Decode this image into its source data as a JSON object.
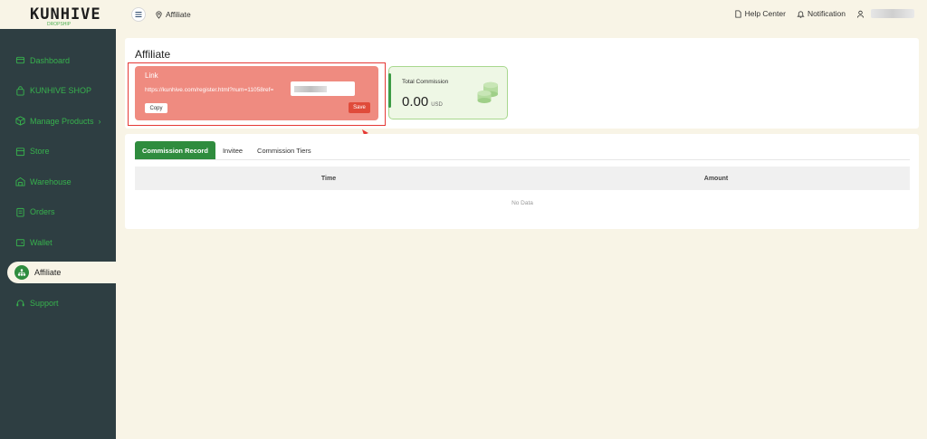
{
  "brand": {
    "logo_text": "KUNHIVE",
    "logo_sub": "DROPSHIP"
  },
  "sidebar": {
    "items": [
      {
        "label": "Dashboard",
        "icon": "dashboard-icon"
      },
      {
        "label": "KUNHIVE SHOP",
        "icon": "bag-icon"
      },
      {
        "label": "Manage Products",
        "icon": "box-icon",
        "chevron": "›"
      },
      {
        "label": "Store",
        "icon": "store-icon"
      },
      {
        "label": "Warehouse",
        "icon": "warehouse-icon"
      },
      {
        "label": "Orders",
        "icon": "orders-icon"
      },
      {
        "label": "Wallet",
        "icon": "wallet-icon"
      },
      {
        "label": "Affiliate",
        "icon": "affiliate-icon",
        "active": true
      },
      {
        "label": "Support",
        "icon": "support-icon"
      }
    ]
  },
  "topbar": {
    "breadcrumb": "Affiliate",
    "help_center": "Help Center",
    "notification": "Notification"
  },
  "page": {
    "title": "Affiliate"
  },
  "link_card": {
    "label": "Link",
    "url": "https://kunhive.com/register.html?num=11058ref=",
    "copy_label": "Copy",
    "save_label": "Save"
  },
  "commission": {
    "label": "Total Commission",
    "value": "0.00",
    "unit": "USD"
  },
  "tabs": [
    {
      "label": "Commission Record",
      "active": true
    },
    {
      "label": "Invitee"
    },
    {
      "label": "Commission Tiers"
    }
  ],
  "table": {
    "columns": [
      "Time",
      "Amount"
    ],
    "empty_text": "No Data"
  },
  "colors": {
    "sidebar_bg": "#2e3e42",
    "accent_green": "#2f8c3e",
    "nav_text": "#37b24d",
    "link_card_bg": "#ef8b80",
    "save_button": "#e04b3a",
    "highlight_border": "#e53935",
    "page_bg": "#f8f4e6"
  }
}
